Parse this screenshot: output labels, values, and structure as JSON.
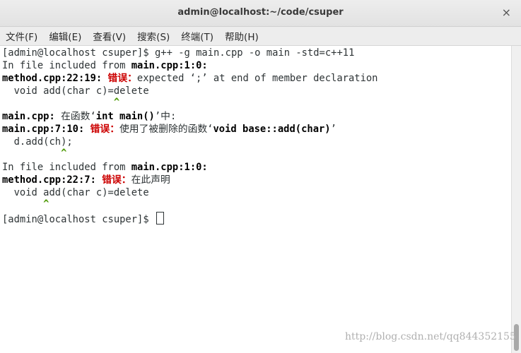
{
  "window": {
    "title": "admin@localhost:~/code/csuper",
    "close_glyph": "×"
  },
  "menu": [
    "文件(F)",
    "编辑(E)",
    "查看(V)",
    "搜索(S)",
    "终端(T)",
    "帮助(H)"
  ],
  "terminal": {
    "prompt1": "[admin@localhost csuper]$ ",
    "command": "g++ -g main.cpp -o main -std=c++11",
    "inc1_pre": "In file included from ",
    "inc1_file": "main.cpp:1:0:",
    "err1_loc": "method.cpp:22:19:",
    "err_label": "错误：",
    "err1_msg": "expected ‘;’ at end of member declaration",
    "code1": "  void add(char c)=delete",
    "caret1": "                   ^",
    "ctx_loc": "main.cpp:",
    "ctx_mid": " 在函数‘",
    "ctx_func": "int main()",
    "ctx_end": "’中:",
    "err2_loc": "main.cpp:7:10:",
    "err2_msg": "使用了被删除的函数‘",
    "err2_func": "void base::add(char)",
    "err2_end": "’",
    "code2": "  d.add(ch);",
    "caret2": "          ^",
    "inc2_pre": "In file included from ",
    "inc2_file": "main.cpp:1:0:",
    "err3_loc": "method.cpp:22:7:",
    "err3_msg": "在此声明",
    "code3": "  void add(char c)=delete",
    "caret3": "       ^",
    "prompt2": "[admin@localhost csuper]$ "
  },
  "watermark": "http://blog.csdn.net/qq844352155"
}
